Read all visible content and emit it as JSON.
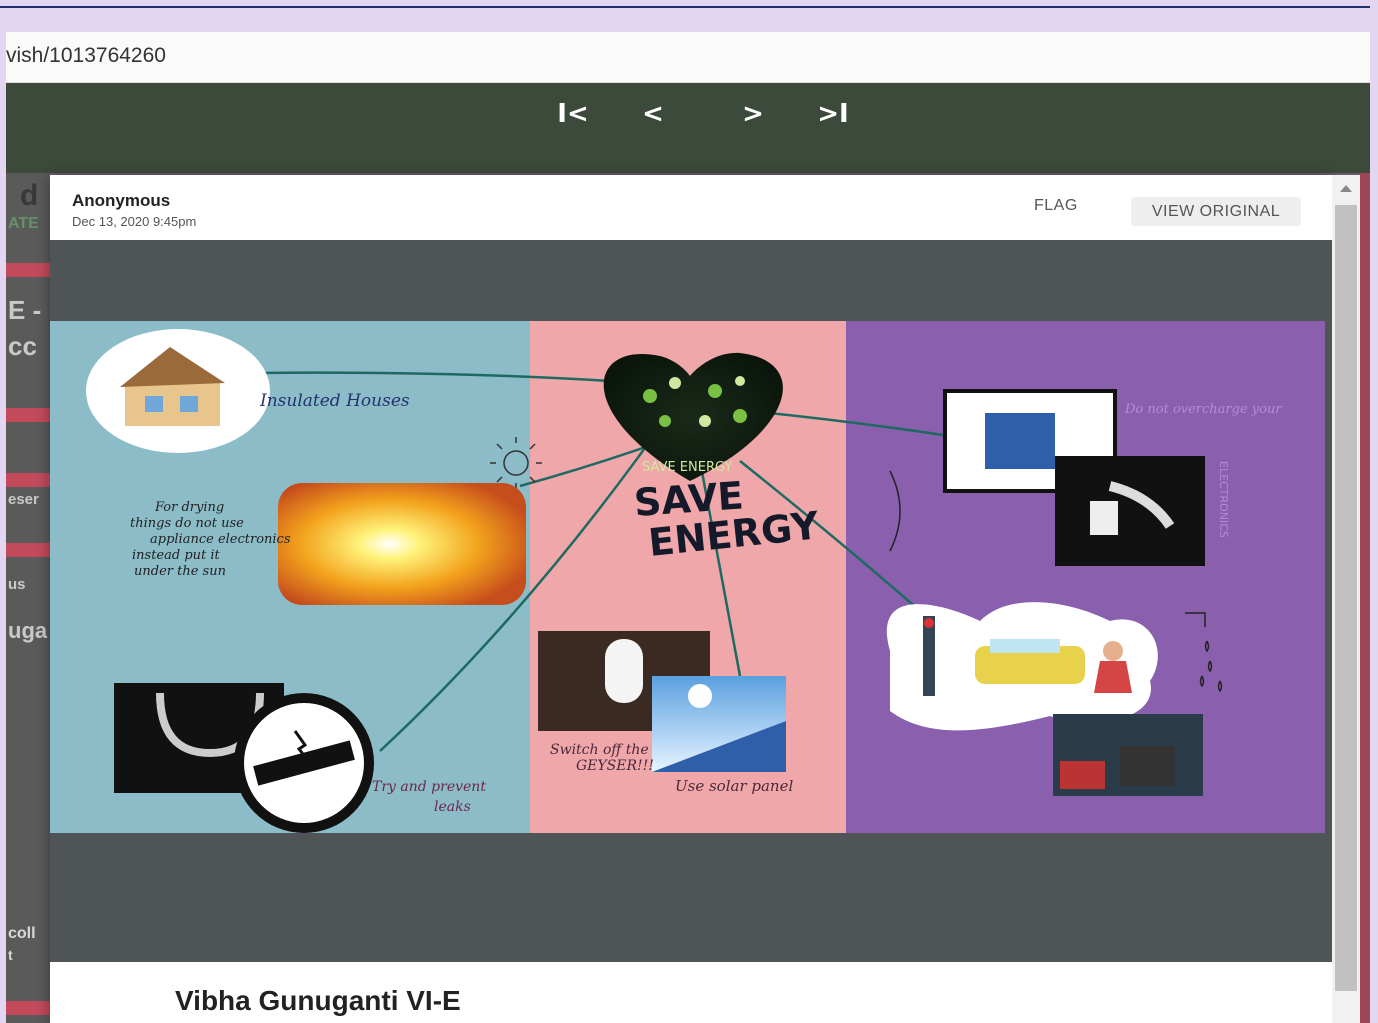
{
  "browser": {
    "url": "vish/1013764260"
  },
  "navigation": {
    "first": "I<",
    "prev": "<",
    "next": ">",
    "last": ">I"
  },
  "background": {
    "texts": [
      "d",
      "ATE",
      "E -",
      "cc",
      "eser",
      "us",
      "uga",
      "coll",
      "t"
    ]
  },
  "post": {
    "author": "Anonymous",
    "date": "Dec 13, 2020 9:45pm",
    "flag_label": "FLAG",
    "view_original_label": "VIEW ORIGINAL",
    "caption": "Vibha Gunuganti VI-E"
  },
  "poster": {
    "heart_label": "SAVE ENERGY",
    "title_line1": "SAVE",
    "title_line2": "ENERGY",
    "notes": {
      "insulated": "Insulated Houses",
      "drying": "For drying things do not use appliance electronics instead put it under the sun",
      "leaks": "Try and prevent leaks",
      "geyser": "Switch off the GEYSER!!!",
      "solar": "Use solar panel",
      "unplug": "Do not overcharge your",
      "electronics": "ELECTRONICS"
    }
  },
  "colors": {
    "appbar": "#3c4a3c",
    "modal_image_bg": "#4f5457",
    "panel_blue": "#8cbcc8",
    "panel_pink": "#f0a7a9",
    "panel_purple": "#8a5fae"
  }
}
